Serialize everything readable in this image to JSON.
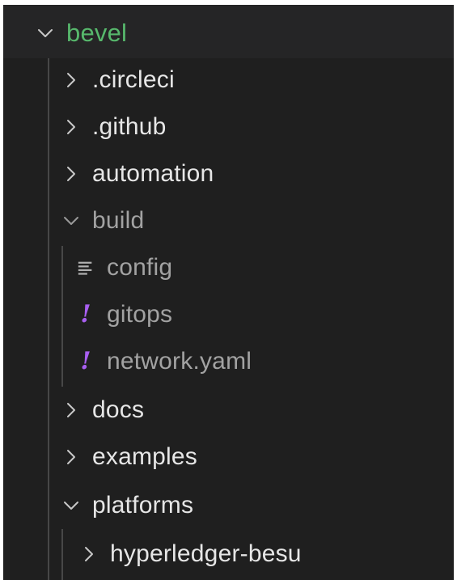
{
  "explorer": {
    "root": {
      "label": "bevel",
      "expanded": true
    },
    "items": [
      {
        "label": ".circleci",
        "type": "folder",
        "expanded": false,
        "depth": 1
      },
      {
        "label": ".github",
        "type": "folder",
        "expanded": false,
        "depth": 1
      },
      {
        "label": "automation",
        "type": "folder",
        "expanded": false,
        "depth": 1
      },
      {
        "label": "build",
        "type": "folder",
        "expanded": true,
        "depth": 1
      },
      {
        "label": "config",
        "type": "file",
        "icon": "text-lines-icon",
        "depth": 2
      },
      {
        "label": "gitops",
        "type": "file",
        "icon": "yaml-exclamation-icon",
        "depth": 2
      },
      {
        "label": "network.yaml",
        "type": "file",
        "icon": "yaml-exclamation-icon",
        "depth": 2
      },
      {
        "label": "docs",
        "type": "folder",
        "expanded": false,
        "depth": 1
      },
      {
        "label": "examples",
        "type": "folder",
        "expanded": false,
        "depth": 1
      },
      {
        "label": "platforms",
        "type": "folder",
        "expanded": true,
        "depth": 1
      },
      {
        "label": "hyperledger-besu",
        "type": "folder",
        "expanded": false,
        "depth": 2
      }
    ]
  },
  "colors": {
    "background": "#1f1f1f",
    "root_label": "#57b86c",
    "label": "#e6e6e6",
    "dim_label": "#a2a2a2",
    "yaml_icon": "#a85ff0",
    "guide": "#474747"
  }
}
